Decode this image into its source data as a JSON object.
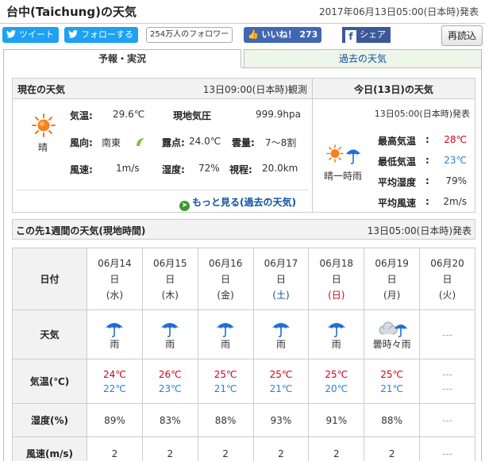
{
  "header": {
    "title": "台中(Taichung)の天気",
    "issued": "2017年06月13日05:00(日本時)発表"
  },
  "social": {
    "tweet": "ツイート",
    "follow": "フォローする",
    "follower_count": "254万人のフォロワー",
    "like": "いいね！ 273",
    "share": "シェア",
    "reload": "再読込"
  },
  "tabs": [
    {
      "label": "予報・実況",
      "active": true
    },
    {
      "label": "過去の天気",
      "active": false
    }
  ],
  "current": {
    "title": "現在の天気",
    "observed": "13日09:00(日本時)観測",
    "weather": "晴",
    "temp_label": "気温:",
    "temp": "29.6℃",
    "pressure_label": "現地気圧",
    "pressure": "999.9hpa",
    "wind_dir_label": "風向:",
    "wind_dir": "南東",
    "dew_label": "露点:",
    "dew": "24.0℃",
    "cloud_label": "雲量:",
    "cloud": "7～8割",
    "wind_speed_label": "風速:",
    "wind_speed": "1m/s",
    "humidity_label": "湿度:",
    "humidity": "72%",
    "visibility_label": "視程:",
    "visibility": "20.0km",
    "more_link": "もっと見る(過去の天気)"
  },
  "today": {
    "title": "今日(13日)の天気",
    "issued": "13日05:00(日本時)発表",
    "weather": "晴一時雨",
    "rows": [
      {
        "label": "最高気温",
        "sep": ":",
        "value": "28℃",
        "color": "#d0021b"
      },
      {
        "label": "最低気温",
        "sep": ":",
        "value": "23℃",
        "color": "#2a7fd4"
      },
      {
        "label": "平均湿度",
        "sep": ":",
        "value": "79%",
        "color": "#333333"
      },
      {
        "label": "平均風速",
        "sep": ":",
        "value": "2m/s",
        "color": "#333333"
      }
    ]
  },
  "week": {
    "title": "この先1週間の天気(現地時間)",
    "issued": "13日05:00(日本時)発表",
    "row_labels": {
      "date": "日付",
      "weather": "天気",
      "temp": "気温(℃)",
      "humidity": "湿度(%)",
      "wind": "風速(m/s)"
    },
    "days": [
      {
        "md": "06月14",
        "d": "日",
        "dow": "(水)",
        "dow_type": "weekday",
        "icon": "umbrella-icon",
        "weather": "雨",
        "hi": "24℃",
        "lo": "22℃",
        "hum": "89%",
        "wind": "2"
      },
      {
        "md": "06月15",
        "d": "日",
        "dow": "(木)",
        "dow_type": "weekday",
        "icon": "umbrella-icon",
        "weather": "雨",
        "hi": "26℃",
        "lo": "23℃",
        "hum": "83%",
        "wind": "2"
      },
      {
        "md": "06月16",
        "d": "日",
        "dow": "(金)",
        "dow_type": "weekday",
        "icon": "umbrella-icon",
        "weather": "雨",
        "hi": "25℃",
        "lo": "21℃",
        "hum": "88%",
        "wind": "2"
      },
      {
        "md": "06月17",
        "d": "日",
        "dow": "(土)",
        "dow_type": "sat",
        "icon": "umbrella-icon",
        "weather": "雨",
        "hi": "25℃",
        "lo": "21℃",
        "hum": "93%",
        "wind": "2"
      },
      {
        "md": "06月18",
        "d": "日",
        "dow": "(日)",
        "dow_type": "sun",
        "icon": "umbrella-icon",
        "weather": "雨",
        "hi": "25℃",
        "lo": "20℃",
        "hum": "91%",
        "wind": "2"
      },
      {
        "md": "06月19",
        "d": "日",
        "dow": "(月)",
        "dow_type": "weekday",
        "icon": "cloud-rain-icon",
        "weather": "曇時々雨",
        "hi": "25℃",
        "lo": "21℃",
        "hum": "88%",
        "wind": "2"
      },
      {
        "md": "06月20",
        "d": "日",
        "dow": "(火)",
        "dow_type": "weekday",
        "icon": "",
        "weather": "---",
        "hi": "---",
        "lo": "---",
        "hum": "---",
        "wind": "---"
      }
    ]
  },
  "colors": {
    "twitter": "#1da1f2",
    "facebook": "#3b5998",
    "link": "#0b51a0",
    "high": "#d0021b",
    "low": "#2a7fd4"
  }
}
